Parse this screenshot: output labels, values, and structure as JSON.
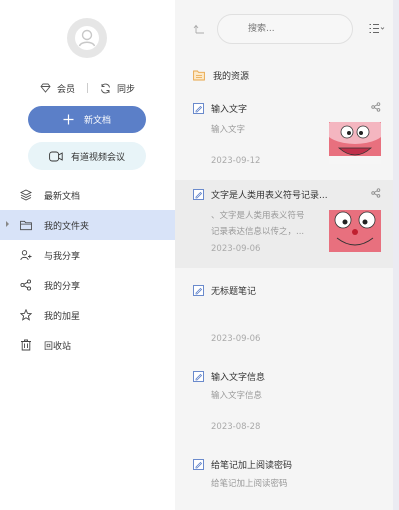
{
  "sidebar": {
    "member_label": "会员",
    "sync_label": "同步",
    "new_doc_label": "新文档",
    "meeting_label": "有道视频会议",
    "items": [
      {
        "label": "最新文档",
        "icon": "layers-icon"
      },
      {
        "label": "我的文件夹",
        "icon": "folder-icon"
      },
      {
        "label": "与我分享",
        "icon": "users-icon"
      },
      {
        "label": "我的分享",
        "icon": "share-icon"
      },
      {
        "label": "我的加星",
        "icon": "star-icon"
      },
      {
        "label": "回收站",
        "icon": "trash-icon"
      }
    ]
  },
  "search": {
    "placeholder": "搜索..."
  },
  "folder": {
    "label": "我的资源"
  },
  "notes": [
    {
      "title": "输入文字",
      "preview": "输入文字",
      "date": "2023-09-12",
      "has_thumb": true
    },
    {
      "title": "文字是人类用表义符号记录...",
      "preview": "、文字是人类用表义符号记录表达信息以传之，...",
      "preview1": "、文字是人类用表义符号",
      "preview2": "记录表达信息以传之，...",
      "date": "2023-09-06",
      "has_thumb": true
    },
    {
      "title": "无标题笔记",
      "preview": "",
      "date": "2023-09-06",
      "has_thumb": false
    },
    {
      "title": "输入文字信息",
      "preview": "输入文字信息",
      "date": "2023-08-28",
      "has_thumb": false
    },
    {
      "title": "给笔记加上阅读密码",
      "preview": "给笔记加上阅读密码",
      "date": "",
      "has_thumb": false
    }
  ],
  "colors": {
    "accent": "#5b7fc8",
    "active_bg": "#d8e3f8",
    "thumb": "#e86a7a"
  }
}
